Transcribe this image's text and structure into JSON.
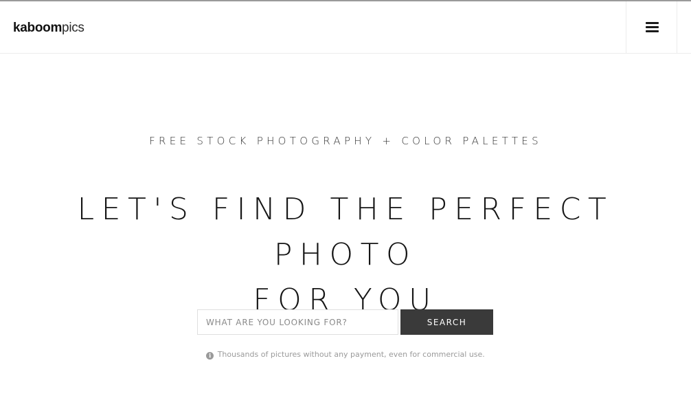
{
  "header": {
    "logo_bold": "kaboom",
    "logo_light": "pics",
    "menu_icon": "hamburger-menu-icon"
  },
  "hero": {
    "tagline": "FREE STOCK PHOTOGRAPHY + COLOR PALETTES",
    "headline_line1": "LET'S FIND THE PERFECT PHOTO",
    "headline_line2": "FOR YOU"
  },
  "search": {
    "placeholder": "WHAT ARE YOU LOOKING FOR?",
    "value": "",
    "button_label": "SEARCH"
  },
  "note": {
    "icon": "info-icon",
    "text": "Thousands of pictures without any payment, even for commercial use."
  },
  "colors": {
    "button_bg": "#3a3a3a",
    "text": "#151515",
    "muted": "#9a9a9a"
  }
}
